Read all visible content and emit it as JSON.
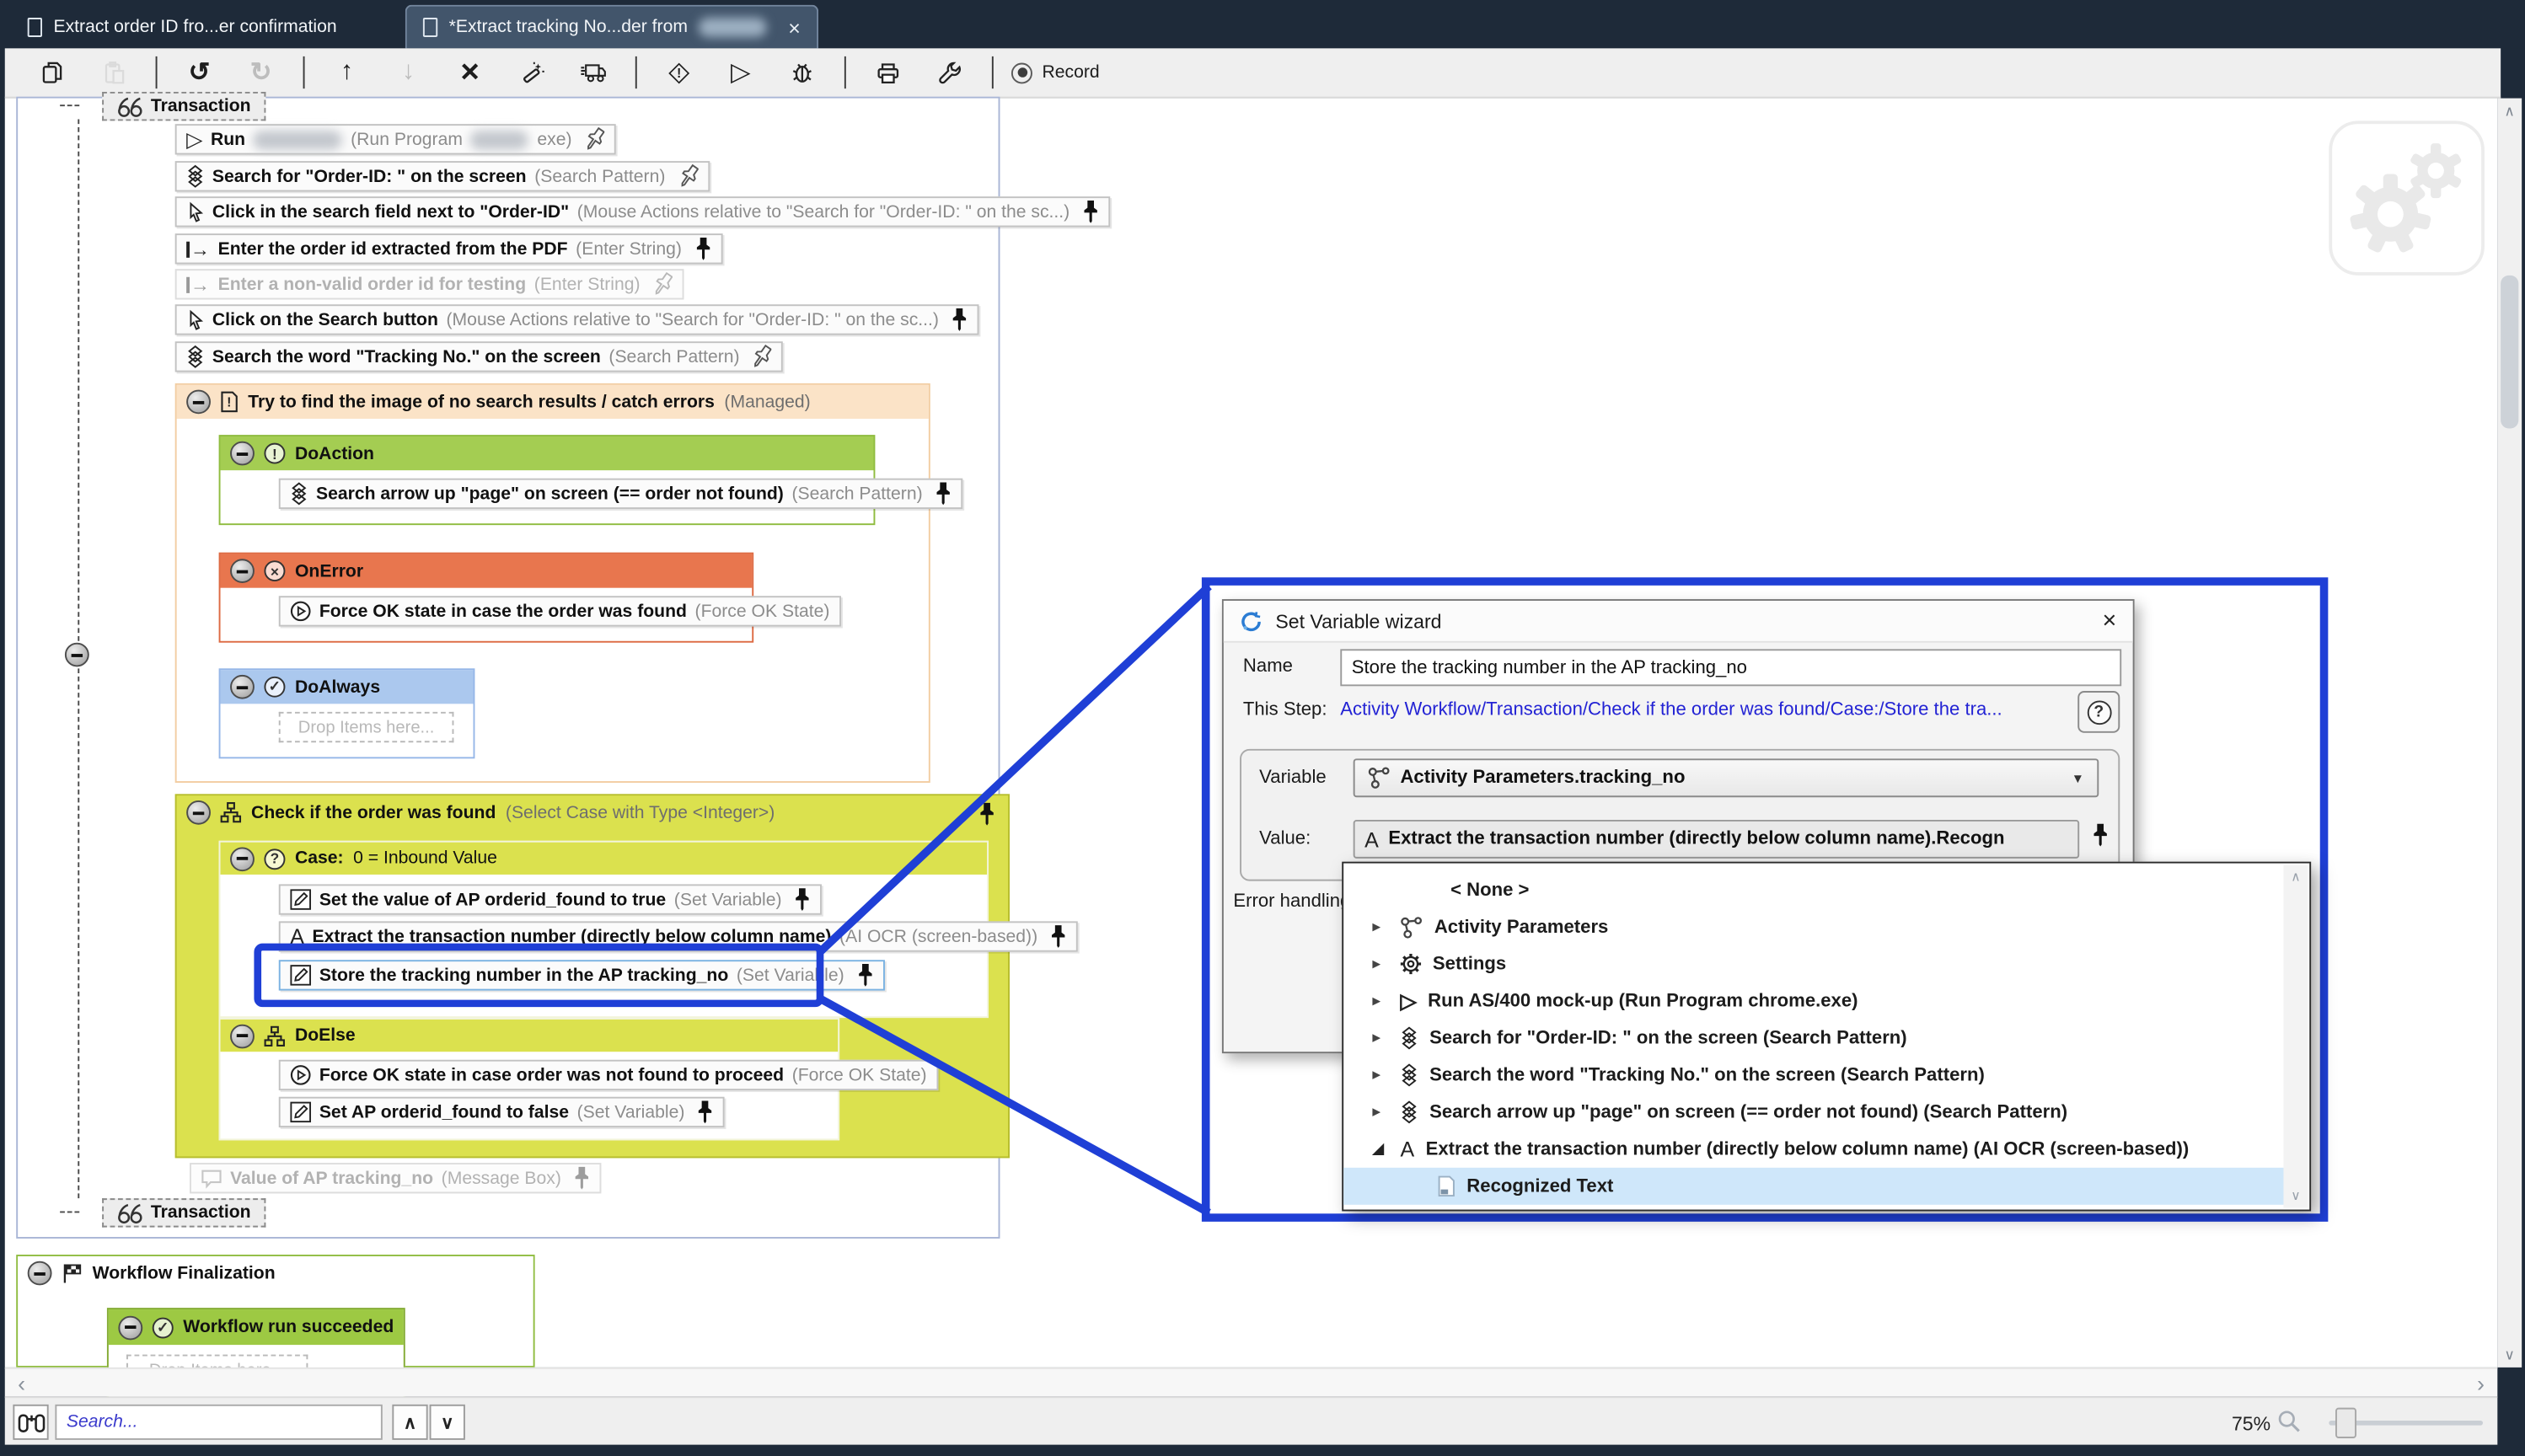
{
  "tabs": {
    "tab1": "Extract order ID fro...er confirmation",
    "tab2": "*Extract tracking No...der from",
    "close_glyph": "×"
  },
  "toolbar": {
    "record_label": "Record",
    "buttons": [
      "copy",
      "paste",
      "undo",
      "redo",
      "move-up",
      "move-down",
      "delete",
      "wand",
      "deploy-run",
      "breakpoint",
      "run",
      "debug",
      "print",
      "tools",
      "record"
    ]
  },
  "workflow": {
    "transaction_start": "Transaction",
    "transaction_end": "Transaction",
    "steps": {
      "run": {
        "label": "Run",
        "type_open": "(Run Program",
        "type_close": "exe)"
      },
      "search_order": {
        "label": "Search for \"Order-ID: \" on the screen",
        "type": "(Search Pattern)"
      },
      "click_field": {
        "label": "Click in the search field next to \"Order-ID\"",
        "type": "(Mouse Actions relative to \"Search for \"Order-ID: \" on the sc...)"
      },
      "enter_order": {
        "label": "Enter the order id extracted from the PDF",
        "type": "(Enter String)"
      },
      "enter_nonvalid": {
        "label": "Enter a non-valid order id for testing",
        "type": "(Enter String)"
      },
      "click_search": {
        "label": "Click on the Search button",
        "type": "(Mouse Actions relative to \"Search for \"Order-ID: \" on the sc...)"
      },
      "search_tracking": {
        "label": "Search the word \"Tracking No.\" on the screen",
        "type": "(Search Pattern)"
      }
    },
    "managed": {
      "label": "Try to find the image of no search results / catch errors",
      "type": "(Managed)",
      "doaction": {
        "label": "DoAction",
        "step": {
          "label": "Search arrow up \"page\" on screen (== order not found)",
          "type": "(Search Pattern)"
        }
      },
      "onerror": {
        "label": "OnError",
        "step": {
          "label": "Force OK state in case the order was found",
          "type": "(Force OK State)"
        }
      },
      "doalways": {
        "label": "DoAlways",
        "drop": "Drop Items here..."
      }
    },
    "check": {
      "label": "Check if the order was found",
      "type": "(Select Case with Type <Integer>)",
      "case": {
        "label_bold": "Case:",
        "label_rest": " 0 = Inbound Value",
        "steps": [
          {
            "label": "Set the value of AP orderid_found to true",
            "type": "(Set Variable)"
          },
          {
            "label": "Extract the transaction number (directly below column name)",
            "type": "(AI OCR (screen-based))"
          },
          {
            "label": "Store the tracking number in the AP tracking_no",
            "type": "(Set Variable)"
          }
        ]
      },
      "doelse": {
        "label": "DoElse",
        "steps": [
          {
            "label": "Force OK state in case order was not found to proceed",
            "type": "(Force OK State)"
          },
          {
            "label": "Set AP orderid_found to false",
            "type": "(Set Variable)"
          }
        ]
      }
    },
    "msgbox": {
      "label": "Value of AP tracking_no",
      "type": "(Message Box)"
    },
    "finalization": {
      "label": "Workflow Finalization",
      "succeeded": "Workflow run succeeded",
      "drop": "Drop Items here..."
    }
  },
  "dialog": {
    "title": "Set Variable wizard",
    "close_glyph": "×",
    "name_label": "Name",
    "name_value": "Store the tracking number in the AP tracking_no",
    "step_label": "This Step:",
    "step_link": "Activity Workflow/Transaction/Check if the order was found/Case:/Store the tra...",
    "variable_label": "Variable",
    "variable_value": "Activity Parameters.tracking_no",
    "value_label": "Value:",
    "value_value": "Extract the transaction number (directly below column name).Recogn",
    "error_handling_label": "Error handling"
  },
  "popup": {
    "items": [
      {
        "label": "< None >"
      },
      {
        "label": "Activity Parameters"
      },
      {
        "label": "Settings"
      },
      {
        "label": "Run AS/400 mock-up  (Run Program chrome.exe)"
      },
      {
        "label": "Search for \"Order-ID: \" on the screen (Search Pattern)"
      },
      {
        "label": "Search the word \"Tracking No.\" on the screen (Search Pattern)"
      },
      {
        "label": "Search arrow up \"page\" on screen (== order not found) (Search Pattern)"
      },
      {
        "label": "Extract the transaction number (directly below column name) (AI OCR (screen-based))"
      },
      {
        "label": "Recognized Text"
      }
    ]
  },
  "statusbar": {
    "search_placeholder": "Search...",
    "zoom": "75%"
  },
  "colors": {
    "accent_blue": "#1f3fd6",
    "selection_blue": "#cfe7fa",
    "link_blue": "#2323d4",
    "green": "#9dc943",
    "orange": "#e8764e",
    "peach": "#fbe3c7",
    "yellow": "#dbe14e",
    "blue_header": "#abc8ee",
    "navy": "#1e2a39"
  }
}
